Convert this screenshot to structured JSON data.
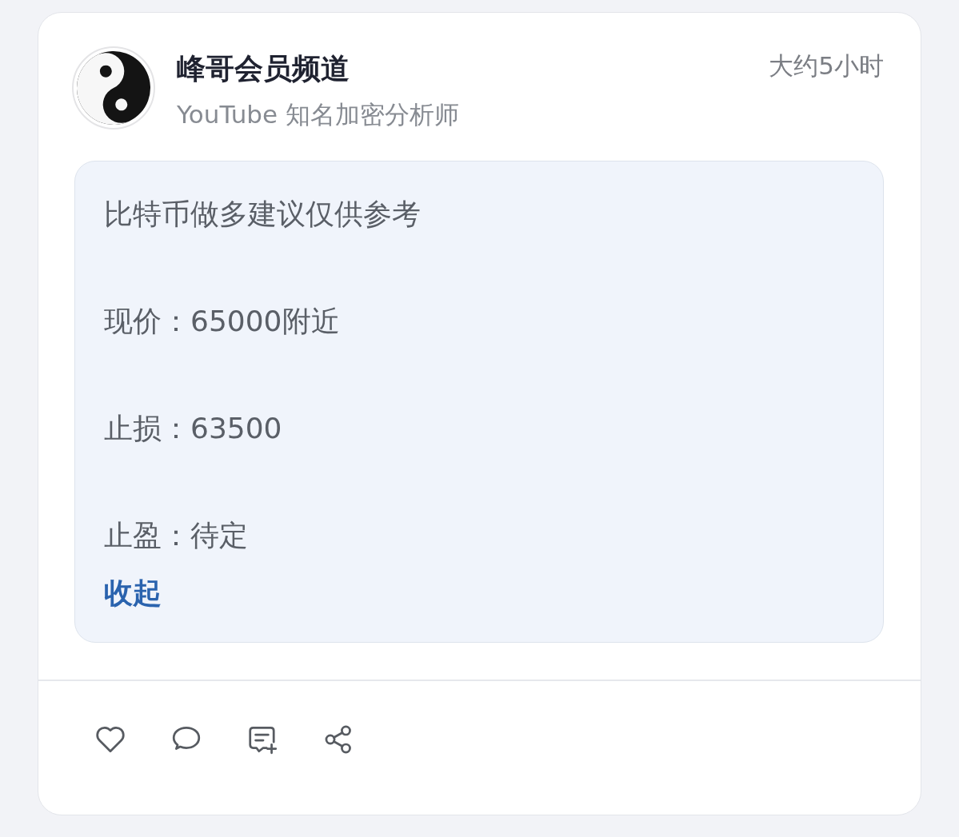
{
  "post": {
    "author": {
      "name": "峰哥会员频道",
      "subtitle": "YouTube 知名加密分析师"
    },
    "time": "大约5小时",
    "content": {
      "paragraphs": [
        "比特币做多建议仅供参考",
        "现价：65000附近",
        "止损：63500",
        "止盈：待定"
      ],
      "collapse_link": "收起"
    },
    "actions": [
      {
        "kind": "like"
      },
      {
        "kind": "comment"
      },
      {
        "kind": "quote"
      },
      {
        "kind": "share"
      }
    ]
  }
}
